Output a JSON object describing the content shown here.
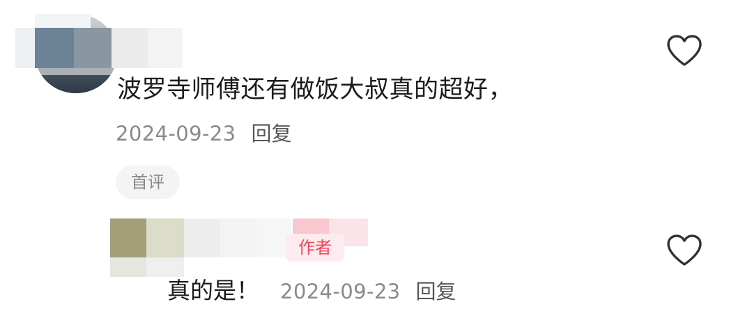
{
  "comments": [
    {
      "text": "波罗寺师傅还有做饭大叔真的超好，",
      "date": "2024-09-23",
      "reply_label": "回复",
      "badge": "首评"
    },
    {
      "author_tag": "作者",
      "text": "真的是！",
      "date": "2024-09-23",
      "reply_label": "回复"
    }
  ],
  "icons": {
    "like": "heart-outline-icon"
  },
  "colors": {
    "text_primary": "#1c1c1c",
    "text_secondary": "#8a8a8a",
    "author_tag": "#f1465e",
    "author_tag_bg": "#fdecef",
    "badge_bg": "#f4f4f4"
  }
}
